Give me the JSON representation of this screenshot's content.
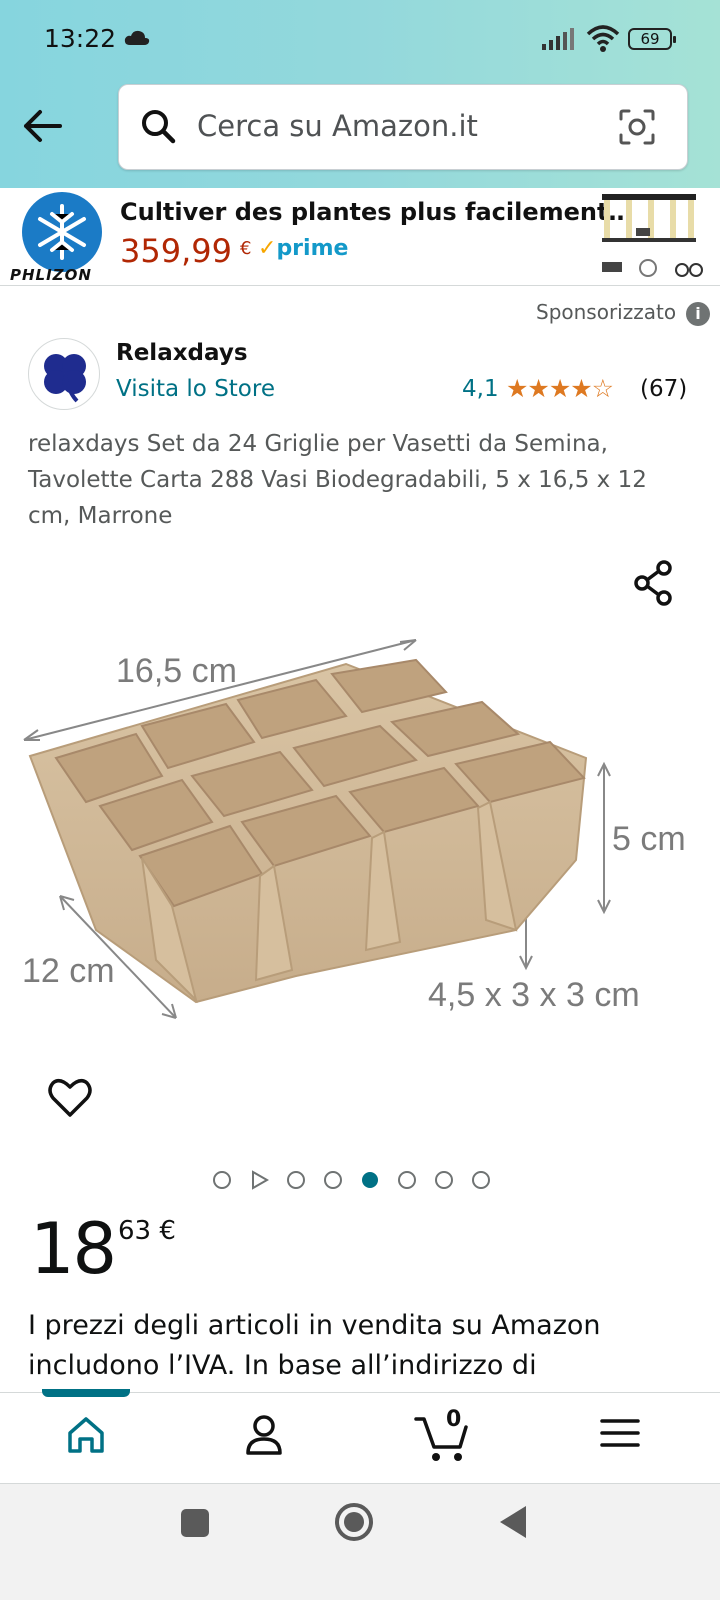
{
  "status_bar": {
    "time": "13:22",
    "battery": "69"
  },
  "search": {
    "placeholder": "Cerca su Amazon.it"
  },
  "ad": {
    "brand": "PHLIZON",
    "title": "Cultiver des plantes plus facilement…",
    "price": "359,99",
    "currency": "€",
    "prime": "prime"
  },
  "sponsored_label": "Sponsorizzato",
  "store": {
    "name": "Relaxdays",
    "link": "Visita lo Store"
  },
  "rating": {
    "value": "4,1",
    "stars": "★★★★☆",
    "count": "(67)"
  },
  "product": {
    "title": "relaxdays Set da 24 Griglie per Vasetti da Semina, Tavolette Carta 288 Vasi Biodegradabili, 5 x 16,5 x 12 cm, Marrone",
    "dim_length": "16,5 cm",
    "dim_height": "5 cm",
    "dim_depth": "12 cm",
    "dim_cell": "4,5 x 3 x 3 cm"
  },
  "carousel": {
    "count": 8,
    "active_index": 4,
    "video_index": 1
  },
  "price": {
    "whole": "18",
    "fraction": "63 €"
  },
  "vat_note": "I prezzi degli articoli in vendita su Amazon includono l’IVA. In base all’indirizzo di",
  "cart": {
    "count": "0"
  },
  "colors": {
    "accent": "#007185",
    "price_ad": "#b12704",
    "stars": "#de7921"
  }
}
